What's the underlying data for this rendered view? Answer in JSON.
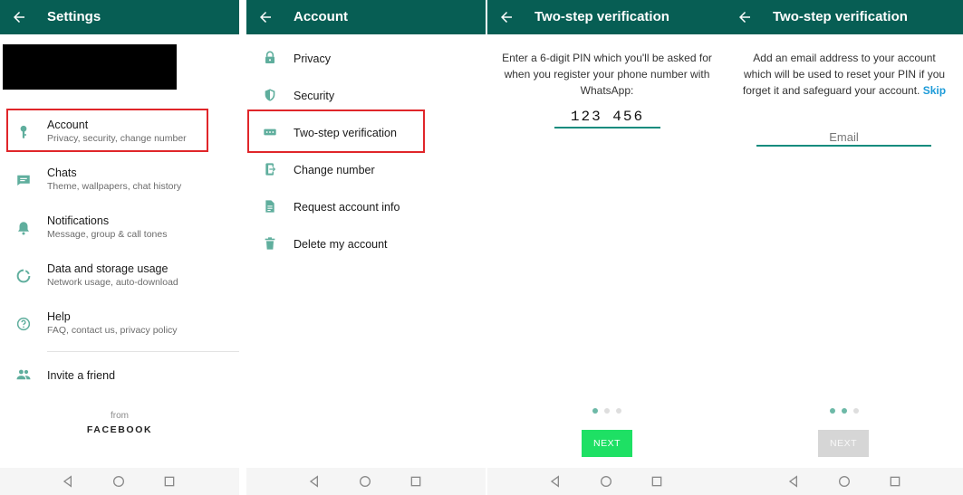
{
  "colors": {
    "appbar": "#075e54",
    "accent": "#128c7e",
    "highlight": "#e0262a",
    "next_active": "#1ee064",
    "link": "#1d9bd8"
  },
  "settings": {
    "title": "Settings",
    "items": [
      {
        "label": "Account",
        "sub": "Privacy, security, change number",
        "icon": "key-icon"
      },
      {
        "label": "Chats",
        "sub": "Theme, wallpapers, chat history",
        "icon": "chat-icon"
      },
      {
        "label": "Notifications",
        "sub": "Message, group & call tones",
        "icon": "bell-icon"
      },
      {
        "label": "Data and storage usage",
        "sub": "Network usage, auto-download",
        "icon": "data-usage-icon"
      },
      {
        "label": "Help",
        "sub": "FAQ, contact us, privacy policy",
        "icon": "help-icon"
      }
    ],
    "invite": "Invite a friend",
    "from": "from",
    "brand": "FACEBOOK"
  },
  "account": {
    "title": "Account",
    "items": [
      {
        "label": "Privacy",
        "icon": "lock-icon"
      },
      {
        "label": "Security",
        "icon": "shield-icon"
      },
      {
        "label": "Two-step verification",
        "icon": "dots-icon"
      },
      {
        "label": "Change number",
        "icon": "phone-change-icon"
      },
      {
        "label": "Request account info",
        "icon": "document-icon"
      },
      {
        "label": "Delete my account",
        "icon": "trash-icon"
      }
    ]
  },
  "pin_step": {
    "title": "Two-step verification",
    "instruction": "Enter a 6-digit PIN which you'll be asked for when you register your phone number with WhatsApp:",
    "pin_value": "123 456",
    "button": "NEXT"
  },
  "email_step": {
    "title": "Two-step verification",
    "instruction": "Add an email address to your account which will be used to reset your PIN if you forget it and safeguard your account.",
    "skip": "Skip",
    "email_placeholder": "Email",
    "button": "NEXT"
  }
}
